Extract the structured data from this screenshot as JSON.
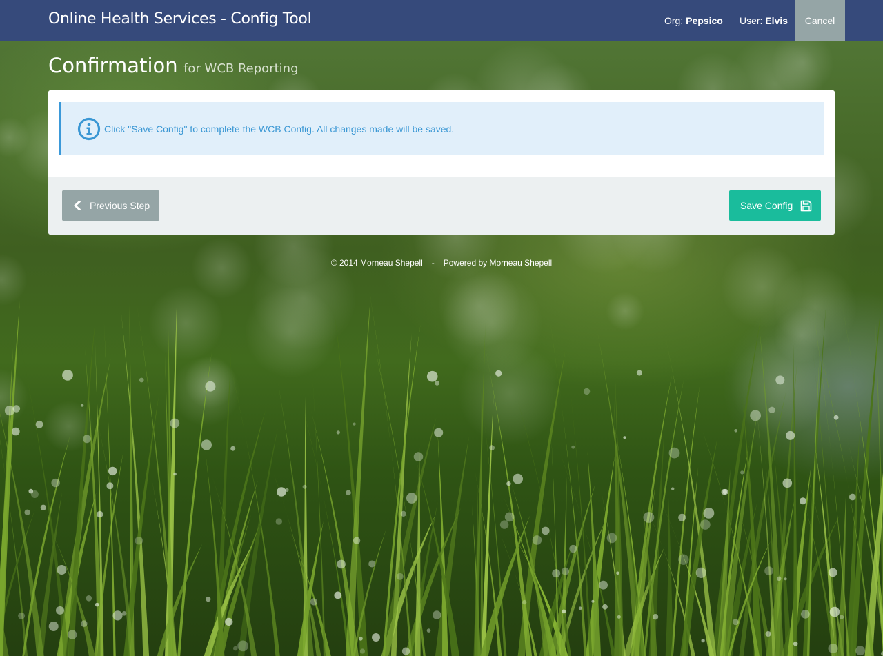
{
  "header": {
    "app_title": "Online Health Services - Config Tool",
    "org_label": "Org:",
    "org_value": "Pepsico",
    "user_label": "User:",
    "user_value": "Elvis",
    "cancel_label": "Cancel"
  },
  "page": {
    "title": "Confirmation",
    "subtitle": "for WCB Reporting"
  },
  "alert": {
    "icon": "info-circle-icon",
    "message": "Click \"Save Config\" to complete the WCB Config. All changes made will be saved."
  },
  "actions": {
    "previous_label": "Previous Step",
    "previous_icon": "chevron-left-icon",
    "save_label": "Save Config",
    "save_icon": "floppy-disk-icon"
  },
  "footer": {
    "copyright": "© 2014 Morneau Shepell",
    "separator": "-",
    "powered_by": "Powered by Morneau Shepell"
  },
  "colors": {
    "navbar": "#364a7b",
    "cancel_button": "#95a5a6",
    "save_button": "#1abc9c",
    "alert_background": "#e1effa",
    "alert_accent": "#3b99d9"
  }
}
